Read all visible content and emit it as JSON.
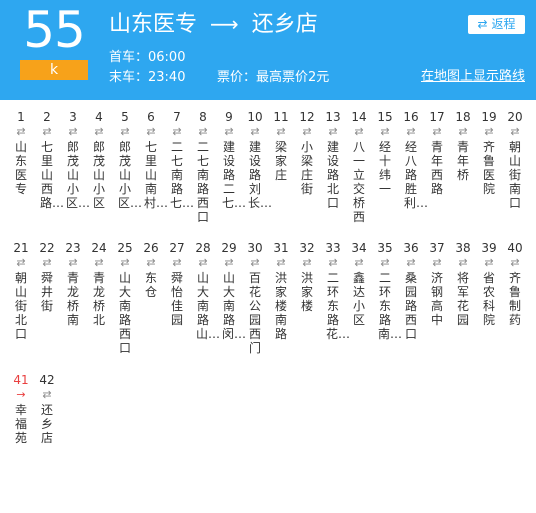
{
  "header": {
    "route_number": "55",
    "route_sub": "k",
    "origin": "山东医专",
    "arrow": "⟶",
    "destination": "还乡店",
    "first_bus": "首车：06:00",
    "last_bus": "末车：23:40",
    "price": "票价：最高票价2元",
    "map_link": "在地图上显示路线",
    "return_label": "返程",
    "return_icon": "⇄"
  },
  "current_stop_index": 41,
  "stops": [
    {
      "num": "1",
      "dir": "⇄",
      "name": "山东医专"
    },
    {
      "num": "2",
      "dir": "⇄",
      "name": "七里山西路…"
    },
    {
      "num": "3",
      "dir": "⇄",
      "name": "郎茂山小区…"
    },
    {
      "num": "4",
      "dir": "⇄",
      "name": "郎茂山小区"
    },
    {
      "num": "5",
      "dir": "⇄",
      "name": "郎茂山小区…"
    },
    {
      "num": "6",
      "dir": "⇄",
      "name": "七里山南村…"
    },
    {
      "num": "7",
      "dir": "⇄",
      "name": "二七南路七…"
    },
    {
      "num": "8",
      "dir": "⇄",
      "name": "二七南路西口"
    },
    {
      "num": "9",
      "dir": "⇄",
      "name": "建设路二七…"
    },
    {
      "num": "10",
      "dir": "⇄",
      "name": "建设路刘长…"
    },
    {
      "num": "11",
      "dir": "⇄",
      "name": "梁家庄"
    },
    {
      "num": "12",
      "dir": "⇄",
      "name": "小梁庄街"
    },
    {
      "num": "13",
      "dir": "⇄",
      "name": "建设路北口"
    },
    {
      "num": "14",
      "dir": "⇄",
      "name": "八一立交桥西"
    },
    {
      "num": "15",
      "dir": "⇄",
      "name": "经十纬一"
    },
    {
      "num": "16",
      "dir": "⇄",
      "name": "经八路胜利…"
    },
    {
      "num": "17",
      "dir": "⇄",
      "name": "青年西路"
    },
    {
      "num": "18",
      "dir": "⇄",
      "name": "青年桥"
    },
    {
      "num": "19",
      "dir": "⇄",
      "name": "齐鲁医院"
    },
    {
      "num": "20",
      "dir": "⇄",
      "name": "朝山街南口"
    },
    {
      "num": "21",
      "dir": "⇄",
      "name": "朝山街北口"
    },
    {
      "num": "22",
      "dir": "⇄",
      "name": "舜井街"
    },
    {
      "num": "23",
      "dir": "⇄",
      "name": "青龙桥南"
    },
    {
      "num": "24",
      "dir": "⇄",
      "name": "青龙桥北"
    },
    {
      "num": "25",
      "dir": "⇄",
      "name": "山大南路西口"
    },
    {
      "num": "26",
      "dir": "⇄",
      "name": "东仓"
    },
    {
      "num": "27",
      "dir": "⇄",
      "name": "舜怡佳园"
    },
    {
      "num": "28",
      "dir": "⇄",
      "name": "山大南路山…"
    },
    {
      "num": "29",
      "dir": "⇄",
      "name": "山大南路闵…"
    },
    {
      "num": "30",
      "dir": "⇄",
      "name": "百花公园西门"
    },
    {
      "num": "31",
      "dir": "⇄",
      "name": "洪家楼南路"
    },
    {
      "num": "32",
      "dir": "⇄",
      "name": "洪家楼"
    },
    {
      "num": "33",
      "dir": "⇄",
      "name": "二环东路花…"
    },
    {
      "num": "34",
      "dir": "⇄",
      "name": "鑫达小区"
    },
    {
      "num": "35",
      "dir": "⇄",
      "name": "二环东路南…"
    },
    {
      "num": "36",
      "dir": "⇄",
      "name": "桑园路西口"
    },
    {
      "num": "37",
      "dir": "⇄",
      "name": "济钢高中"
    },
    {
      "num": "38",
      "dir": "⇄",
      "name": "将军花园"
    },
    {
      "num": "39",
      "dir": "⇄",
      "name": "省农科院"
    },
    {
      "num": "40",
      "dir": "⇄",
      "name": "齐鲁制药"
    },
    {
      "num": "41",
      "dir": "→",
      "name": "幸福苑"
    },
    {
      "num": "42",
      "dir": "⇄",
      "name": "还乡店"
    }
  ]
}
